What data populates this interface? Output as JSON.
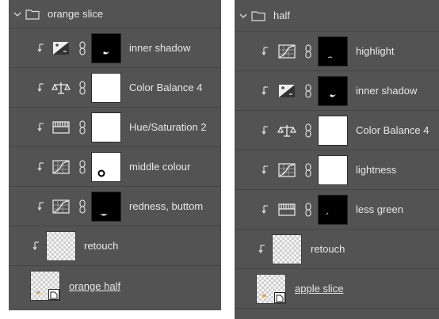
{
  "left_panel": {
    "group_name": "orange slice",
    "layers": [
      {
        "name": "inner shadow",
        "icon": "exposure-icon",
        "mask": "black"
      },
      {
        "name": "Color Balance 4",
        "icon": "color-balance-icon",
        "mask": "white"
      },
      {
        "name": "Hue/Saturation 2",
        "icon": "hue-saturation-icon",
        "mask": "white"
      },
      {
        "name": "middle colour",
        "icon": "curves-icon",
        "mask": "white"
      },
      {
        "name": "redness, buttom",
        "icon": "curves-icon",
        "mask": "black"
      }
    ],
    "retouch": "retouch",
    "smart_object": "orange half"
  },
  "right_panel": {
    "group_name": "half",
    "layers": [
      {
        "name": "highlight",
        "icon": "curves-icon",
        "mask": "black"
      },
      {
        "name": "inner shadow",
        "icon": "exposure-icon",
        "mask": "black"
      },
      {
        "name": "Color Balance 4",
        "icon": "color-balance-icon",
        "mask": "white"
      },
      {
        "name": "lightness",
        "icon": "curves-icon",
        "mask": "white"
      },
      {
        "name": "less green",
        "icon": "hue-saturation-icon",
        "mask": "black"
      }
    ],
    "retouch": "retouch",
    "smart_object": "apple slice"
  },
  "colors": {
    "panel": "#535353",
    "text": "#e6e6e6"
  }
}
